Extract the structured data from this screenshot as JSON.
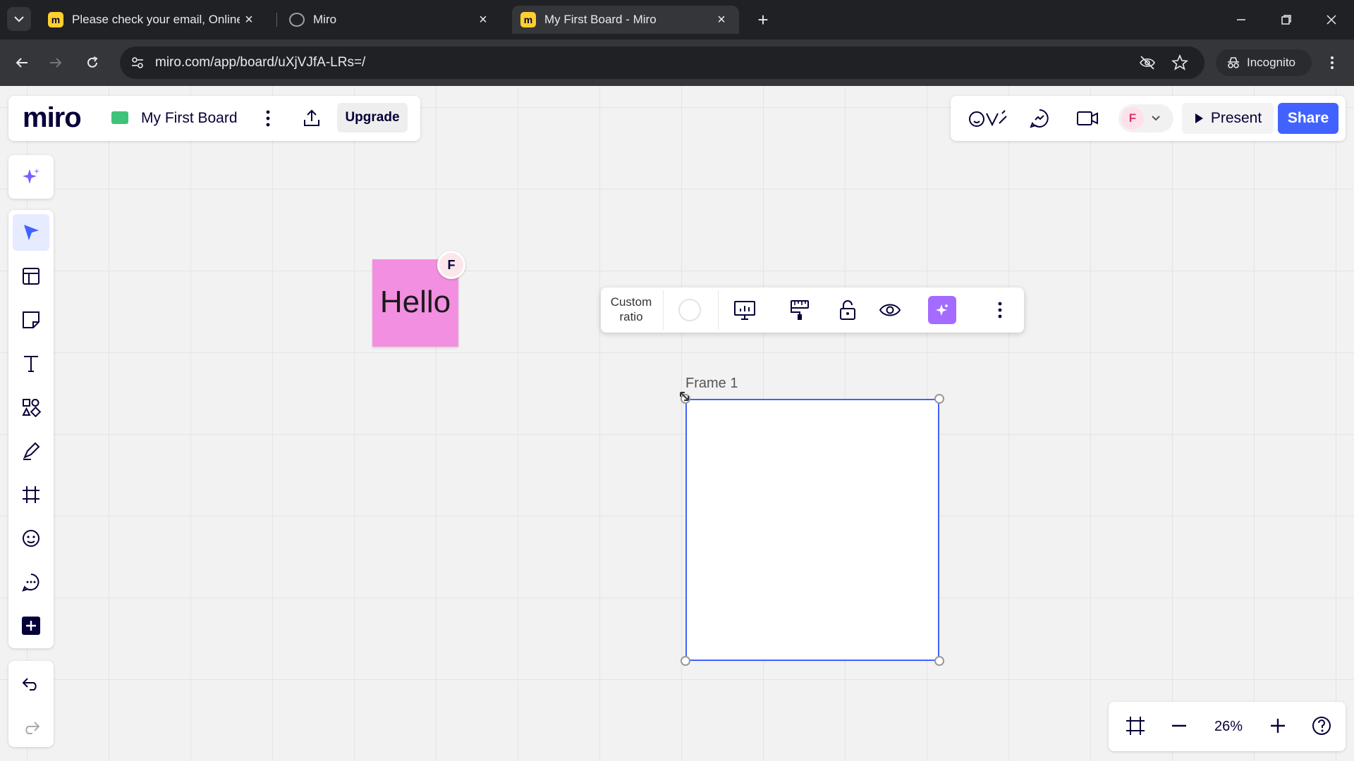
{
  "browser": {
    "tabs": [
      {
        "title": "Please check your email, Online",
        "favicon": "miro-icon",
        "close": "×"
      },
      {
        "title": "Miro",
        "favicon": "globe-icon",
        "close": "×"
      },
      {
        "title": "My First Board - Miro",
        "favicon": "miro-icon",
        "close": "×",
        "active": true
      }
    ],
    "new_tab": "+",
    "url": "miro.com/app/board/uXjVJfA-LRs=/",
    "incognito_label": "Incognito"
  },
  "board": {
    "logo": "miro",
    "name": "My First Board",
    "upgrade_label": "Upgrade",
    "present_label": "Present",
    "share_label": "Share",
    "avatar_initial": "F",
    "accent_color": "#4262ff"
  },
  "sticky": {
    "text": "Hello",
    "author_initial": "F",
    "color": "#f28fe0"
  },
  "context_toolbar": {
    "ratio_line1": "Custom",
    "ratio_line2": "ratio"
  },
  "frame": {
    "label": "Frame 1"
  },
  "zoom": {
    "level": "26%"
  }
}
